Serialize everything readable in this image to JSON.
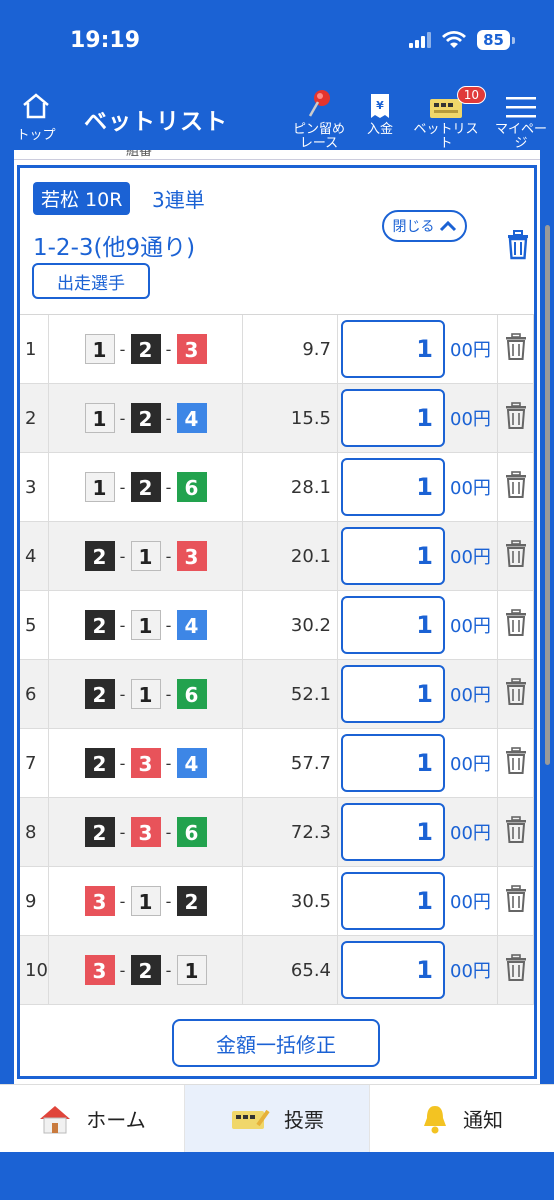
{
  "status": {
    "time": "19:19",
    "battery": "85"
  },
  "header": {
    "home_label": "トップ",
    "title": "ベットリスト",
    "pin_label": "ピン留め\nレース",
    "deposit_label": "入金",
    "betlist_label": "ベットリスト",
    "betlist_badge": "10",
    "mypage_label": "マイページ"
  },
  "scrolled_header": {
    "text": "組番"
  },
  "card": {
    "venue_race": "若松 10R",
    "bet_type": "3連単",
    "combo_summary": "1-2-3(他9通り)",
    "close_label": "閉じる",
    "racers_label": "出走選手",
    "unit_label": "00円",
    "bulk_edit_label": "金額一括修正",
    "rows": [
      {
        "no": "1",
        "boats": [
          "1",
          "2",
          "3"
        ],
        "odds": "9.7",
        "amount": "1"
      },
      {
        "no": "2",
        "boats": [
          "1",
          "2",
          "4"
        ],
        "odds": "15.5",
        "amount": "1"
      },
      {
        "no": "3",
        "boats": [
          "1",
          "2",
          "6"
        ],
        "odds": "28.1",
        "amount": "1"
      },
      {
        "no": "4",
        "boats": [
          "2",
          "1",
          "3"
        ],
        "odds": "20.1",
        "amount": "1"
      },
      {
        "no": "5",
        "boats": [
          "2",
          "1",
          "4"
        ],
        "odds": "30.2",
        "amount": "1"
      },
      {
        "no": "6",
        "boats": [
          "2",
          "1",
          "6"
        ],
        "odds": "52.1",
        "amount": "1"
      },
      {
        "no": "7",
        "boats": [
          "2",
          "3",
          "4"
        ],
        "odds": "57.7",
        "amount": "1"
      },
      {
        "no": "8",
        "boats": [
          "2",
          "3",
          "6"
        ],
        "odds": "72.3",
        "amount": "1"
      },
      {
        "no": "9",
        "boats": [
          "3",
          "1",
          "2"
        ],
        "odds": "30.5",
        "amount": "1"
      },
      {
        "no": "10",
        "boats": [
          "3",
          "2",
          "1"
        ],
        "odds": "65.4",
        "amount": "1"
      }
    ]
  },
  "boat_colors": {
    "1": {
      "bg": "#f2f2f2",
      "fg": "#222222",
      "border": "#bbbbbb"
    },
    "2": {
      "bg": "#2b2b2b",
      "fg": "#ffffff",
      "border": "#2b2b2b"
    },
    "3": {
      "bg": "#e8535a",
      "fg": "#ffffff",
      "border": "#e8535a"
    },
    "4": {
      "bg": "#3d86e6",
      "fg": "#ffffff",
      "border": "#3d86e6"
    },
    "6": {
      "bg": "#22a24e",
      "fg": "#ffffff",
      "border": "#22a24e"
    }
  },
  "tabbar": {
    "home_label": "ホーム",
    "vote_label": "投票",
    "notify_label": "通知"
  },
  "colors": {
    "accent": "#1b62d4",
    "badge": "#e03a3a"
  },
  "icons": [
    "home-icon",
    "pin-icon",
    "deposit-icon",
    "betlist-icon",
    "menu-icon",
    "chevron-up-icon",
    "trash-icon",
    "house-icon",
    "ticket-icon",
    "bell-icon"
  ]
}
